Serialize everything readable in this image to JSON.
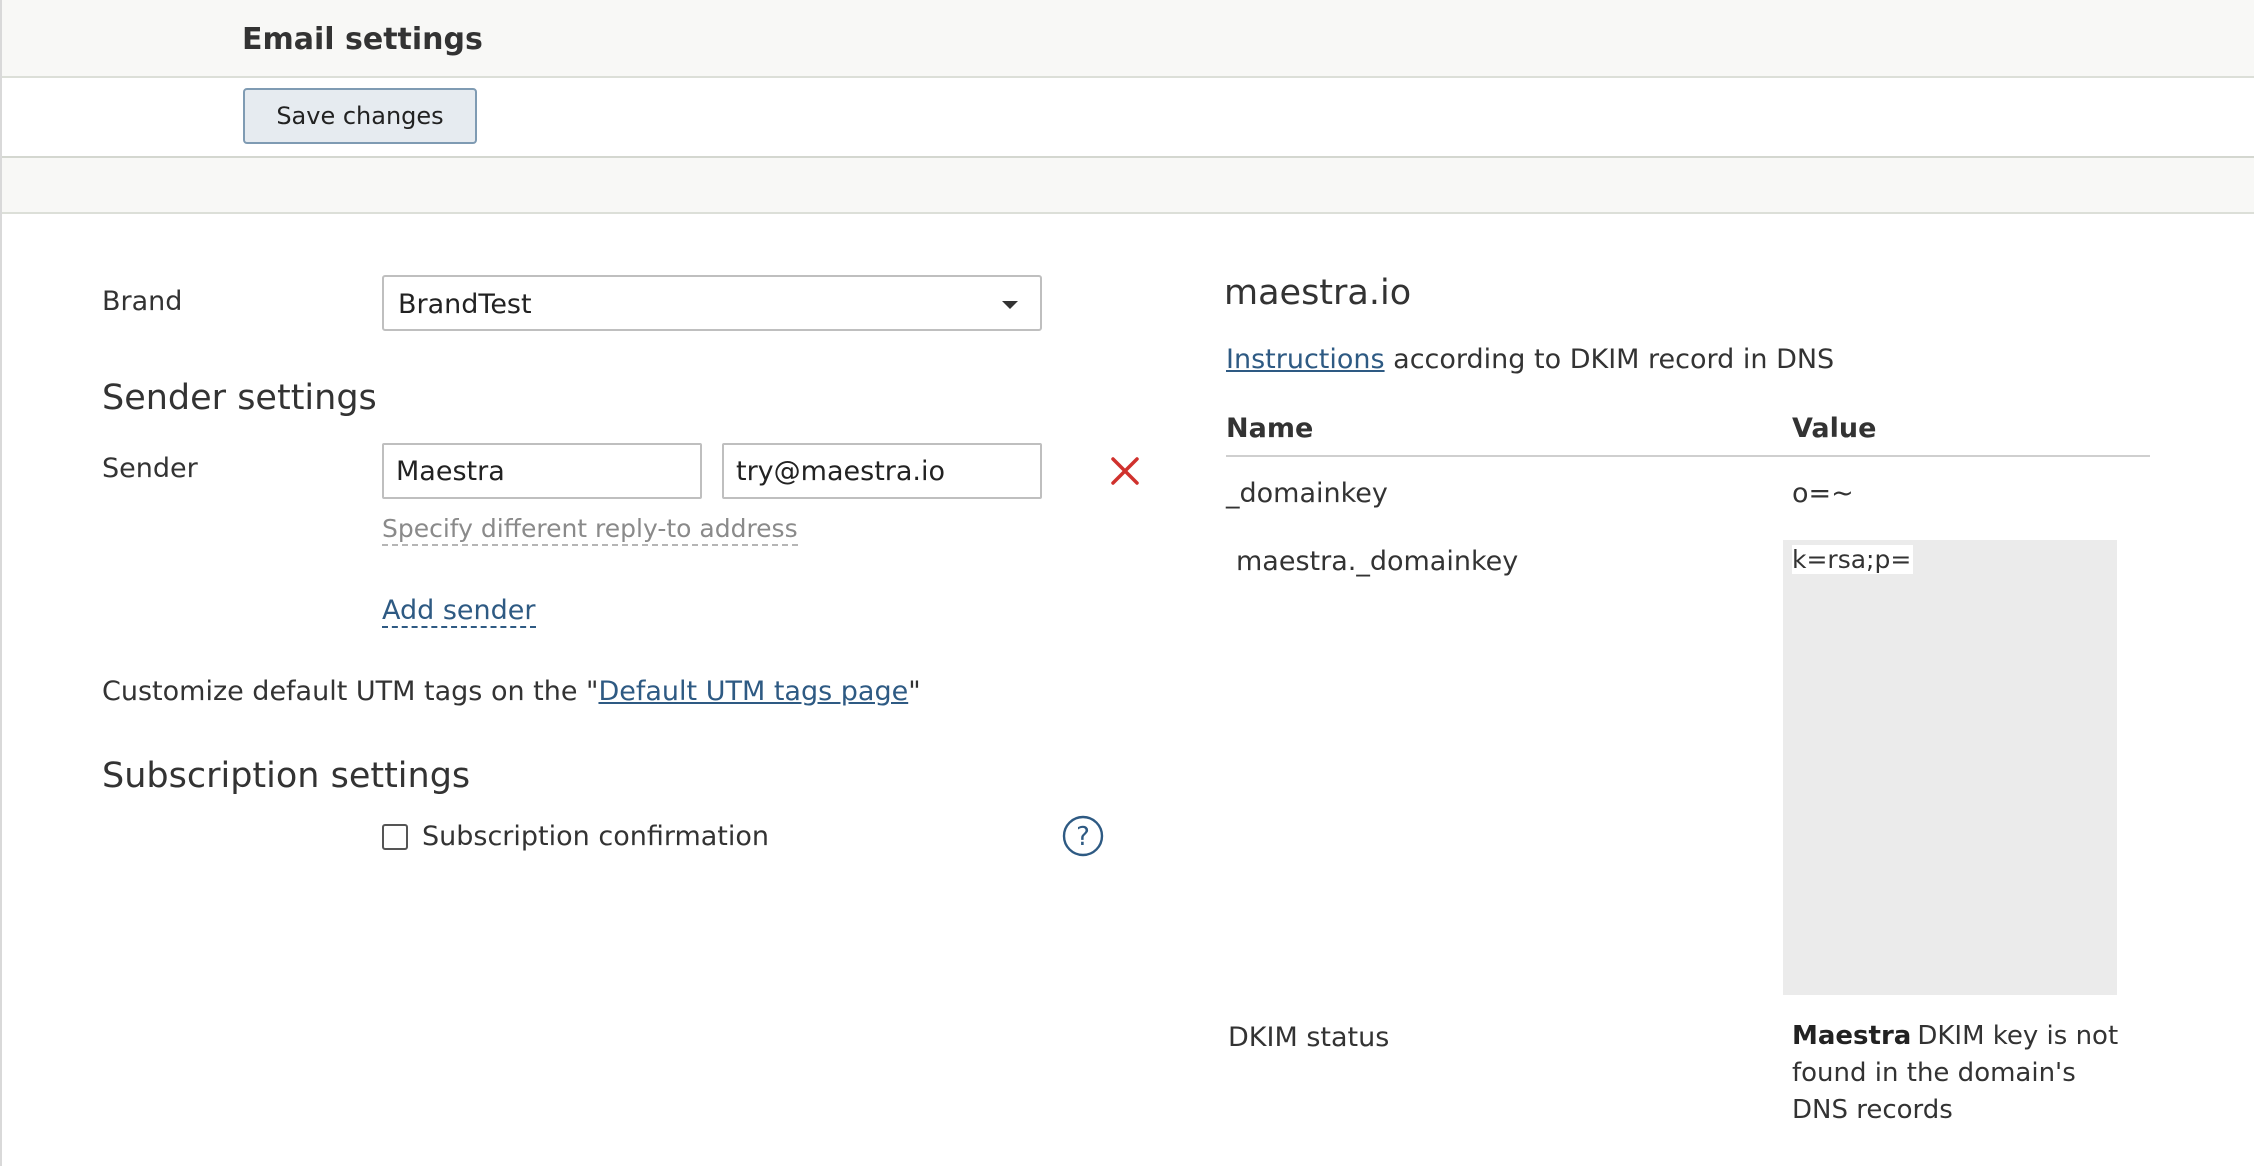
{
  "header": {
    "title": "Email settings"
  },
  "toolbar": {
    "save_label": "Save changes"
  },
  "form": {
    "brand_label": "Brand",
    "brand_value": "BrandTest",
    "sender_settings_heading": "Sender settings",
    "sender_label": "Sender",
    "sender_name_value": "Maestra",
    "sender_email_value": "try@maestra.io",
    "reply_to_link": "Specify different reply-to address",
    "add_sender_link": "Add sender",
    "utm_prefix": "Customize default UTM tags on the \"",
    "utm_link": "Default UTM tags page",
    "utm_suffix": "\"",
    "subscription_heading": "Subscription settings",
    "subscription_checkbox_label": "Subscription confirmation"
  },
  "dkim": {
    "domain": "maestra.io",
    "instructions_link": "Instructions",
    "instructions_suffix": " according to DKIM record in DNS",
    "table": {
      "headers": {
        "name": "Name",
        "value": "Value"
      },
      "rows": [
        {
          "name": "_domainkey",
          "value": "o=~"
        },
        {
          "name_prefix": "maestra",
          "name_suffix": "._domainkey",
          "value": "k=rsa;p="
        }
      ]
    },
    "status_label": "DKIM status",
    "status_brand": "Maestra",
    "status_message": "DKIM key is not found in the domain's DNS records"
  },
  "colors": {
    "accent_link": "#2e5a83",
    "remove_icon": "#d0312d",
    "header_bg": "#f8f8f6",
    "button_bg": "#e6ebf0",
    "button_border": "#7f9bb3"
  },
  "icons": {
    "dropdown": "chevron-down-icon",
    "remove": "close-icon",
    "help": "question-mark-icon"
  }
}
